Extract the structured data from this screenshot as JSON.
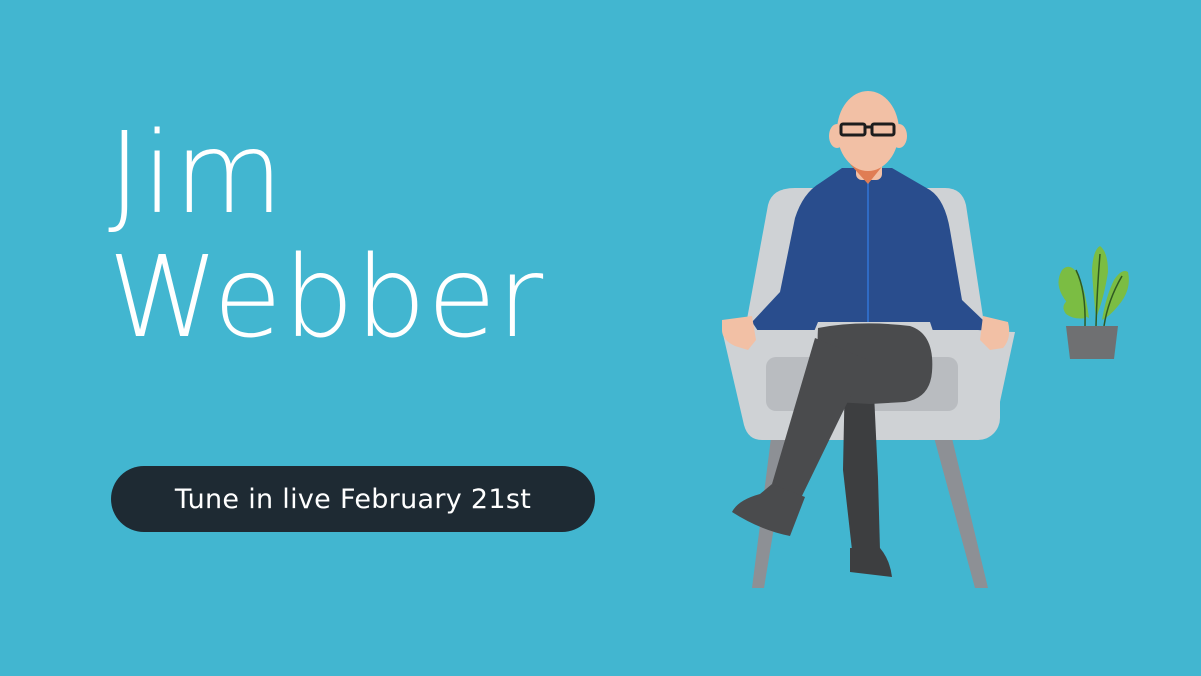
{
  "banner": {
    "background_color": "#42b6d0",
    "name_line1": "Jim",
    "name_line2": "Webber",
    "cta_label": "Tune in live February 21st",
    "cta_color": "#1e2a33"
  },
  "illustration": {
    "figure": "man-seated-in-armchair",
    "accessory": "potted-plant",
    "colors": {
      "chair": "#cfd2d5",
      "chair_legs": "#8d9095",
      "shirt": "#294d8d",
      "trousers": "#4a4b4d",
      "skin": "#f2c0a5",
      "glasses": "#1d1d1d",
      "plant_leaves": "#7bbd43",
      "plant_pot": "#6f7072"
    }
  }
}
